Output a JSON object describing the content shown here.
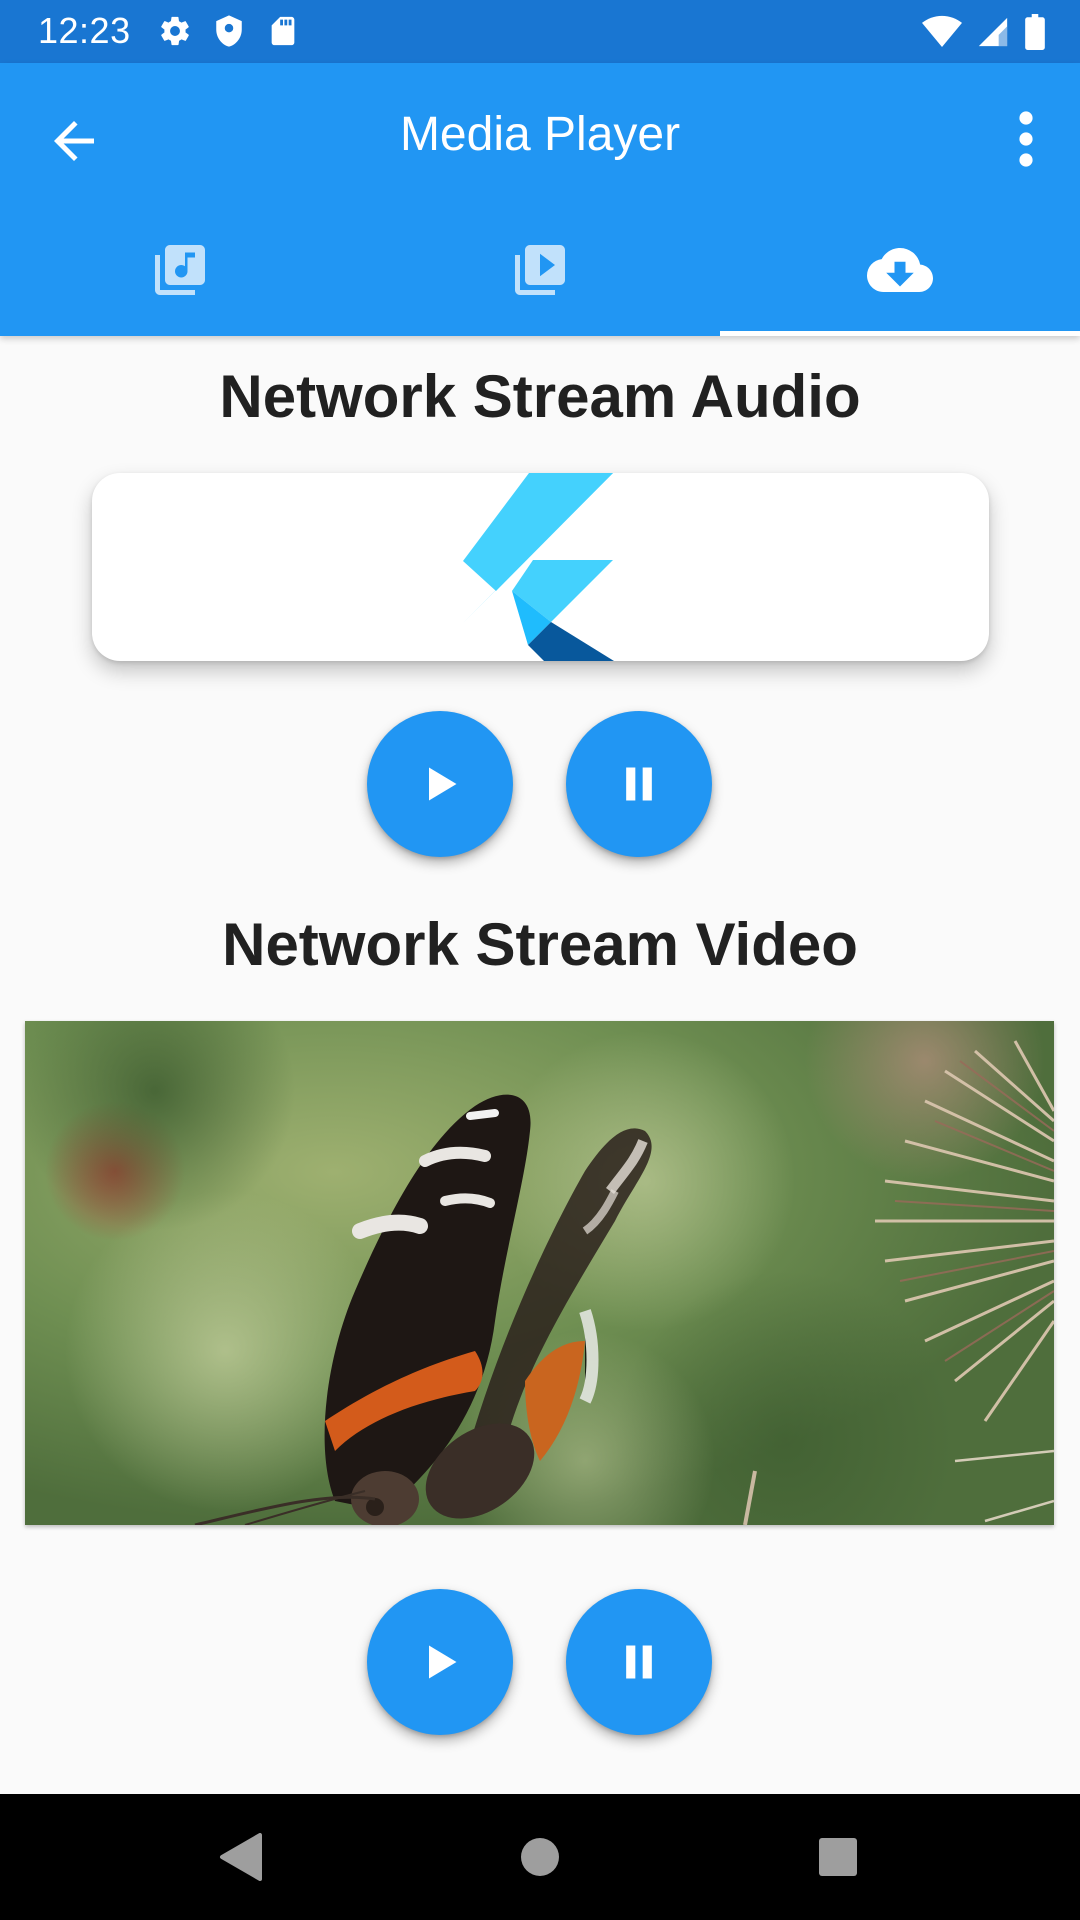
{
  "status_bar": {
    "time": "12:23",
    "icons_left": [
      "gear-icon",
      "shield-icon",
      "sd-card-icon"
    ],
    "icons_right": [
      "wifi-icon",
      "cell-signal-icon",
      "battery-icon"
    ],
    "background": "#1976d2"
  },
  "app_bar": {
    "title": "Media Player",
    "background": "#2196f3",
    "back_icon": "arrow-back-icon",
    "menu_icon": "more-vert-icon"
  },
  "tabs": [
    {
      "icon": "library-music-icon",
      "selected": false
    },
    {
      "icon": "video-library-icon",
      "selected": false
    },
    {
      "icon": "cloud-download-icon",
      "selected": true
    }
  ],
  "audio_section": {
    "title": "Network Stream Audio",
    "artwork": "flutter-logo",
    "controls": [
      "play-icon",
      "pause-icon"
    ]
  },
  "video_section": {
    "title": "Network Stream Video",
    "thumbnail": "butterfly on thistle",
    "controls": [
      "play-icon",
      "pause-icon"
    ]
  },
  "colors": {
    "accent": "#2196f3",
    "dark_accent": "#1976d2",
    "text": "#212121"
  },
  "nav_bar": {
    "buttons": [
      "back-triangle-icon",
      "home-circle-icon",
      "recents-square-icon"
    ]
  }
}
